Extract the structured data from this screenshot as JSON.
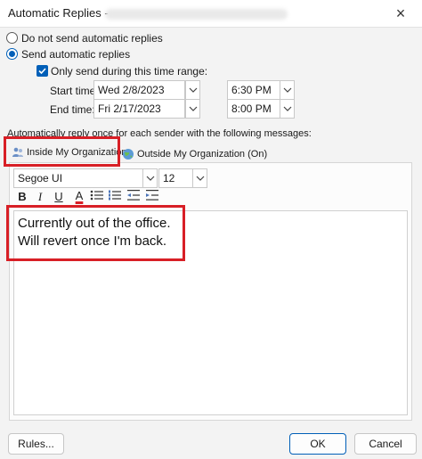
{
  "window": {
    "title": "Automatic Replies -",
    "close_glyph": "×"
  },
  "mode": {
    "do_not_send_label": "Do not send automatic replies",
    "send_label": "Send automatic replies",
    "selected": "send"
  },
  "time_range": {
    "only_send_label": "Only send during this time range:",
    "checked": true,
    "start_label": "Start time:",
    "start_date": "Wed 2/8/2023",
    "start_time": "6:30 PM",
    "end_label": "End time:",
    "end_date": "Fri 2/17/2023",
    "end_time": "8:00 PM"
  },
  "reply_section": {
    "label": "Automatically reply once for each sender with the following messages:"
  },
  "tabs": [
    {
      "label": "Inside My Organization",
      "active": true,
      "icon": "people-icon"
    },
    {
      "label": "Outside My Organization (On)",
      "active": false,
      "icon": "globe-icon"
    }
  ],
  "format": {
    "font": "Segoe UI",
    "size": "12",
    "bold": "B",
    "italic": "I",
    "underline": "U",
    "font_color": "A"
  },
  "message": {
    "text": "Currently out of the office.\nWill revert once I'm back."
  },
  "buttons": {
    "rules": "Rules...",
    "ok": "OK",
    "cancel": "Cancel"
  },
  "colors": {
    "accent": "#005fb8",
    "highlight_box": "#d81f26"
  }
}
